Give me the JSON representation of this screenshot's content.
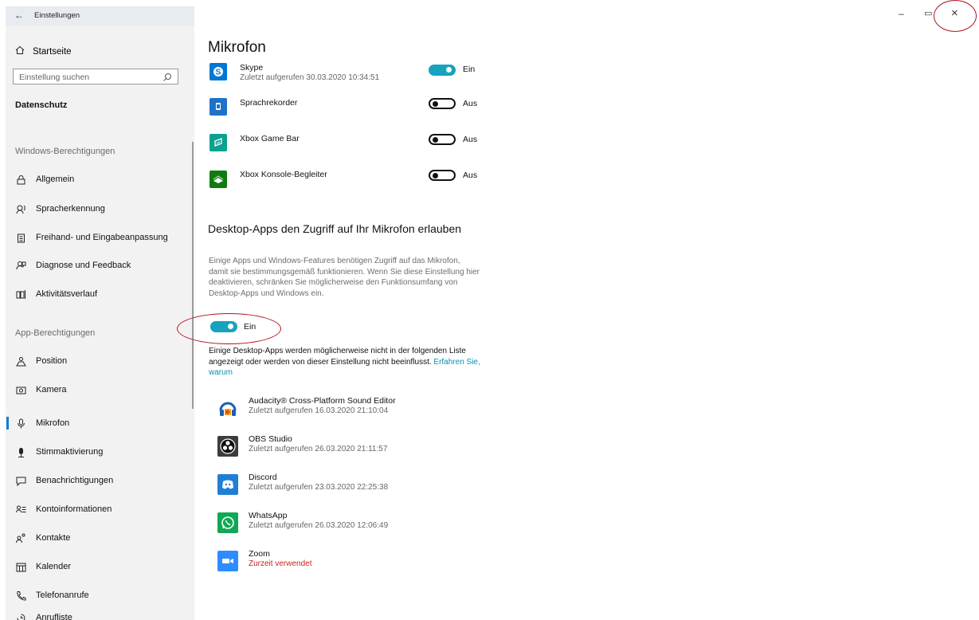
{
  "window": {
    "title": "Einstellungen",
    "back": "←",
    "minimize": "–",
    "restore": "▭",
    "close": "×"
  },
  "sidebar": {
    "home": "Startseite",
    "search_placeholder": "Einstellung suchen",
    "category": "Datenschutz",
    "windows_header": "Windows-Berechtigungen",
    "windows_items": [
      {
        "label": "Allgemein",
        "icon": "lock-icon"
      },
      {
        "label": "Spracherkennung",
        "icon": "speech-icon"
      },
      {
        "label": "Freihand- und Eingabeanpassung",
        "icon": "clipboard-icon"
      },
      {
        "label": "Diagnose und Feedback",
        "icon": "feedback-icon"
      },
      {
        "label": "Aktivitätsverlauf",
        "icon": "timeline-icon"
      }
    ],
    "app_header": "App-Berechtigungen",
    "app_items": [
      {
        "label": "Position",
        "icon": "position-icon"
      },
      {
        "label": "Kamera",
        "icon": "camera-icon"
      },
      {
        "label": "Mikrofon",
        "icon": "microphone-icon",
        "active": true
      },
      {
        "label": "Stimmaktivierung",
        "icon": "voice-activation-icon"
      },
      {
        "label": "Benachrichtigungen",
        "icon": "notification-icon"
      },
      {
        "label": "Kontoinformationen",
        "icon": "account-info-icon"
      },
      {
        "label": "Kontakte",
        "icon": "contacts-icon"
      },
      {
        "label": "Kalender",
        "icon": "calendar-icon"
      },
      {
        "label": "Telefonanrufe",
        "icon": "phone-icon"
      },
      {
        "label": "Anrufliste",
        "icon": "call-history-icon"
      }
    ]
  },
  "main": {
    "title": "Mikrofon",
    "store_apps": [
      {
        "name": "Skype",
        "sub": "Zuletzt aufgerufen 30.03.2020 10:34:51",
        "state": "Ein",
        "on": true
      },
      {
        "name": "Sprachrekorder",
        "sub": "",
        "state": "Aus",
        "on": false
      },
      {
        "name": "Xbox Game Bar",
        "sub": "",
        "state": "Aus",
        "on": false
      },
      {
        "name": "Xbox Konsole-Begleiter",
        "sub": "",
        "state": "Aus",
        "on": false
      }
    ],
    "desktop_title": "Desktop-Apps den Zugriff auf Ihr Mikrofon erlauben",
    "desktop_desc": "Einige Apps und Windows-Features benötigen Zugriff auf das Mikrofon, damit sie bestimmungsgemäß funktionieren. Wenn Sie diese Einstellung hier deaktivieren, schränken Sie möglicherweise den Funktionsumfang von Desktop-Apps und Windows ein.",
    "desktop_toggle": "Ein",
    "desktop_note": "Einige Desktop-Apps werden möglicherweise nicht in der folgenden Liste angezeigt oder werden von dieser Einstellung nicht beeinflusst.",
    "desktop_link": "Erfahren Sie, warum",
    "desktop_apps": [
      {
        "name": "Audacity® Cross-Platform Sound Editor",
        "sub": "Zuletzt aufgerufen 16.03.2020 21:10:04"
      },
      {
        "name": "OBS Studio",
        "sub": "Zuletzt aufgerufen 26.03.2020 21:11:57"
      },
      {
        "name": "Discord",
        "sub": "Zuletzt aufgerufen 23.03.2020 22:25:38"
      },
      {
        "name": "WhatsApp",
        "sub": "Zuletzt aufgerufen 26.03.2020 12:06:49"
      },
      {
        "name": "Zoom",
        "sub": "Zurzeit verwendet"
      }
    ]
  },
  "colors": {
    "accent": "#17a2bd",
    "link": "#0a8fb5",
    "in_use": "#d21e1e",
    "annotation": "#b3121e"
  }
}
